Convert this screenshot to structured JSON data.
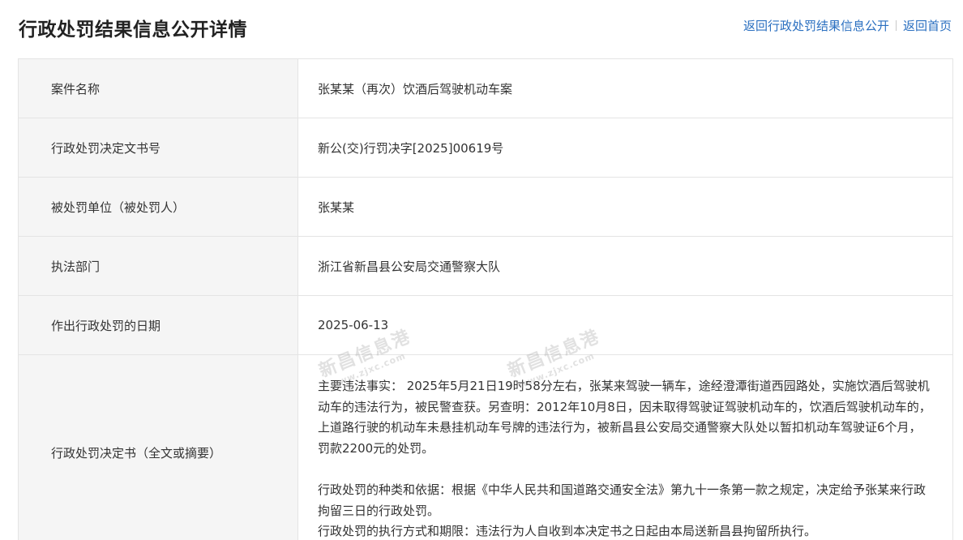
{
  "header": {
    "title": "行政处罚结果信息公开详情",
    "links": [
      "返回行政处罚结果信息公开",
      "返回首页"
    ]
  },
  "rows": [
    {
      "label": "案件名称",
      "value": "张某某（再次）饮酒后驾驶机动车案"
    },
    {
      "label": "行政处罚决定文书号",
      "value": "新公(交)行罚决字[2025]00619号"
    },
    {
      "label": "被处罚单位（被处罚人）",
      "value": "张某某"
    },
    {
      "label": "执法部门",
      "value": "浙江省新昌县公安局交通警察大队"
    },
    {
      "label": "作出行政处罚的日期",
      "value": "2025-06-13"
    }
  ],
  "decision": {
    "label": "行政处罚决定书（全文或摘要）",
    "paragraphs": [
      "主要违法事实： 2025年5月21日19时58分左右，张某来驾驶一辆车，途经澄潭街道西园路处，实施饮酒后驾驶机动车的违法行为，被民警查获。另查明：2012年10月8日，因未取得驾驶证驾驶机动车的，饮酒后驾驶机动车的，上道路行驶的机动车未悬挂机动车号牌的违法行为，被新昌县公安局交通警察大队处以暂扣机动车驾驶证6个月，罚款2200元的处罚。",
      "行政处罚的种类和依据：根据《中华人民共和国道路交通安全法》第九十一条第一款之规定，决定给予张某来行政拘留三日的行政处罚。",
      "行政处罚的执行方式和期限：违法行为人自收到本决定书之日起由本局送新昌县拘留所执行。"
    ]
  },
  "watermarks": [
    {
      "text": "新昌信息港",
      "sub": "www.zjxc.com"
    },
    {
      "text": "新昌信息港",
      "sub": "www.zjxc.com"
    }
  ]
}
